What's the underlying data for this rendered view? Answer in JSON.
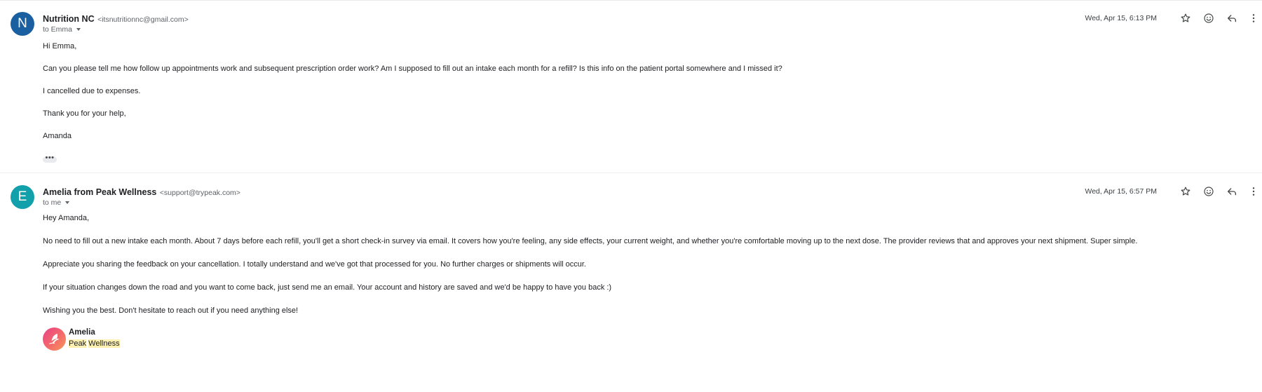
{
  "messages": [
    {
      "avatar_letter": "N",
      "sender_name": "Nutrition NC",
      "sender_email": "<itsnutritionnc@gmail.com>",
      "recipient": "to Emma",
      "timestamp": "Wed, Apr 15, 6:13 PM",
      "body": [
        "Hi Emma,",
        "Can you please tell me how follow up appointments work and subsequent prescription order work? Am I supposed to fill out an intake each month for a refill? Is this info on the patient portal somewhere and I missed it?",
        "I cancelled due to expenses.",
        "Thank you for your help,",
        "Amanda"
      ],
      "trimmed_content": "•••"
    },
    {
      "avatar_letter": "E",
      "sender_name": "Amelia from Peak Wellness",
      "sender_email": "<support@trypeak.com>",
      "recipient": "to me",
      "timestamp": "Wed, Apr 15, 6:57 PM",
      "body": [
        "Hey Amanda,",
        "No need to fill out a new intake each month. About 7 days before each refill, you'll get a short check-in survey via email. It covers how you're feeling, any side effects, your current weight, and whether you're comfortable moving up to the next dose. The provider reviews that and approves your next shipment. Super simple.",
        "Appreciate you sharing the feedback on your cancellation. I totally understand and we've got that processed for you. No further charges or shipments will occur.",
        "If your situation changes down the road and you want to come back, just send me an email. Your account and history are saved and we'd be happy to have you back :)",
        "Wishing you the best. Don't hesitate to reach out if you need anything else!"
      ],
      "signature": {
        "name": "Amelia",
        "company_word1": "Peak",
        "company_word2": "Wellness"
      }
    }
  ],
  "icons": {
    "star": "star-icon",
    "emoji": "emoji-reaction-icon",
    "reply": "reply-icon",
    "more": "more-vertical-icon"
  },
  "colors": {
    "avatar_n": "#1a5fa0",
    "avatar_e": "#12a0ab",
    "highlight": "#fdf0b0"
  }
}
